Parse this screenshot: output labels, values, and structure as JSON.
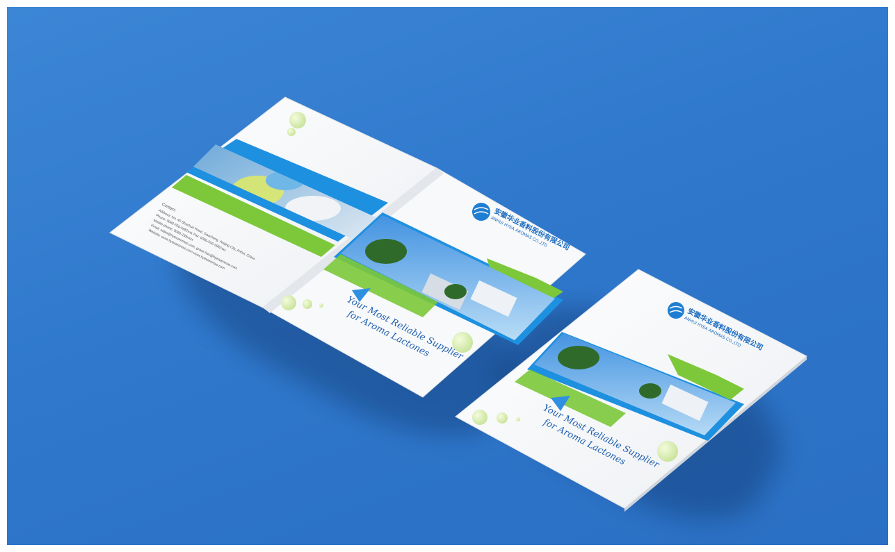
{
  "brand": {
    "name_cn": "安徽华业香料股份有限公司",
    "name_en": "ANHUI HYEA AROMAS CO.,LTD",
    "tagline_line1": "Your Most Reliable Supplier",
    "tagline_line2": "for Aroma Lactones"
  },
  "contact": {
    "heading": "Contact:",
    "lines": [
      "Address: No. 40 Shuchun Road, Gaocheng, Anqing City, Anhui, China",
      "Phone: 0086-556-5982xxx    Fax: 0086-556-5982xxx",
      "Mobile phone: 0086-139xxxx",
      "Email: sales@hyeaaromas.com, grace.hao@hyeaaromas.com",
      "Website: www.hyeaaromas.com  www.hyeaaromas.com"
    ]
  },
  "colors": {
    "background": "#2f78cc",
    "accent_blue": "#1e90e0",
    "accent_green": "#7cc83a",
    "paper": "#f7f8fa"
  }
}
